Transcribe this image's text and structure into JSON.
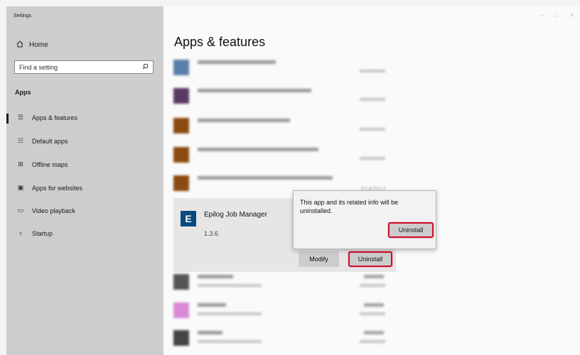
{
  "window": {
    "title": "Settings"
  },
  "sidebar": {
    "home": {
      "label": "Home",
      "icon": "home-icon"
    },
    "search": {
      "placeholder": "Find a setting",
      "icon": "search-icon"
    },
    "section": "Apps",
    "items": [
      {
        "label": "Apps & features",
        "icon": "apps-features-icon",
        "selected": true
      },
      {
        "label": "Default apps",
        "icon": "default-apps-icon"
      },
      {
        "label": "Offline maps",
        "icon": "offline-maps-icon"
      },
      {
        "label": "Apps for websites",
        "icon": "apps-for-websites-icon"
      },
      {
        "label": "Video playback",
        "icon": "video-playback-icon"
      },
      {
        "label": "Startup",
        "icon": "startup-icon"
      }
    ]
  },
  "main": {
    "title": "Apps & features",
    "blurred_date": "2/14/2017",
    "selected_app": {
      "name": "Epilog Job Manager",
      "version": "1.3.6",
      "icon": "epilog-app-icon",
      "icon_letter": "E",
      "modify_label": "Modify",
      "uninstall_label": "Uninstall"
    },
    "flyout": {
      "message": "This app and its related info will be uninstalled.",
      "uninstall_label": "Uninstall"
    }
  },
  "colors": {
    "sidebar_bg": "#cdcdcd",
    "main_bg": "#fafafa",
    "highlight": "#c8102e",
    "app_icon": "#0a4a7e"
  }
}
